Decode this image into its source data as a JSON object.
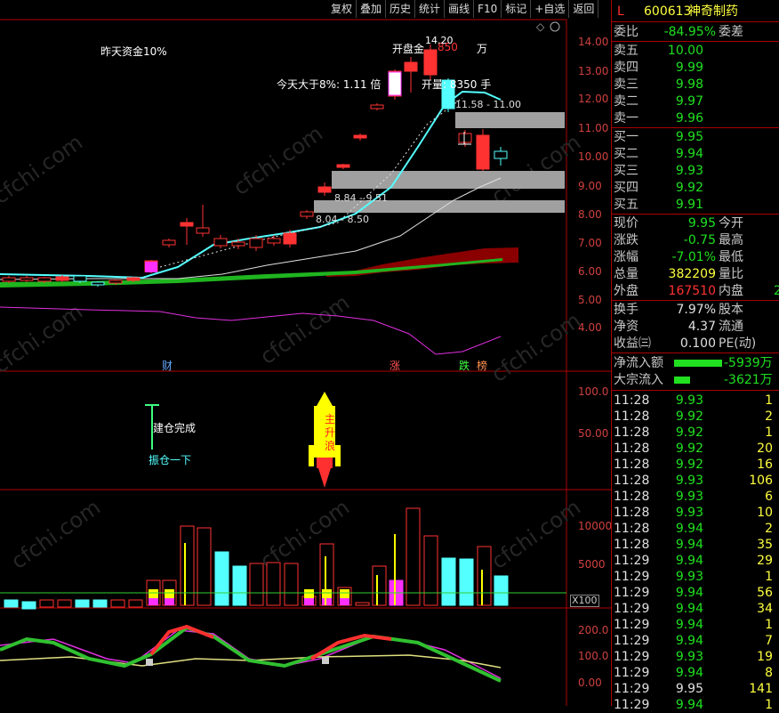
{
  "toolbar": [
    "复权",
    "叠加",
    "历史",
    "统计",
    "画线",
    "F10",
    "标记",
    "+自选",
    "返回"
  ],
  "stock": {
    "marker": "L",
    "code": "600613",
    "name": "神奇制药"
  },
  "annotations": {
    "prev_fund": "昨天资金10%",
    "today_gt8": "今天大于8%: 1.11 倍",
    "open_fund": "开盘金",
    "open_fund_val": "850",
    "open_fund_unit": "万",
    "open_volume": "开量: 8350 手",
    "high_label": "14.20",
    "range1": "11.58 - 11.00",
    "range2": "8.84 - 9.51",
    "range3": "8.04 - 8.50",
    "jiancang": "建仓完成",
    "zhencang": "振仓一下",
    "rocket": "主升浪",
    "cai": "财",
    "zhang": "涨",
    "die": "跌",
    "xian": "榜",
    "x100": "X100"
  },
  "price_axis": [
    "14.00",
    "13.00",
    "12.00",
    "11.00",
    "10.00",
    "9.00",
    "8.00",
    "7.00",
    "6.00",
    "5.00",
    "4.00"
  ],
  "ind1_axis": [
    "100.0",
    "50.00"
  ],
  "vol_axis": [
    "10000",
    "5000"
  ],
  "ind2_axis": [
    "200.0",
    "100.0",
    "0.00"
  ],
  "quote": {
    "weibi_label": "委比",
    "weibi_val": "-84.95%",
    "weicha_label": "委差",
    "sell": [
      {
        "label": "卖五",
        "price": "10.00"
      },
      {
        "label": "卖四",
        "price": "9.99"
      },
      {
        "label": "卖三",
        "price": "9.98"
      },
      {
        "label": "卖二",
        "price": "9.97"
      },
      {
        "label": "卖一",
        "price": "9.96"
      }
    ],
    "buy": [
      {
        "label": "买一",
        "price": "9.95"
      },
      {
        "label": "买二",
        "price": "9.94"
      },
      {
        "label": "买三",
        "price": "9.93"
      },
      {
        "label": "买四",
        "price": "9.92"
      },
      {
        "label": "买五",
        "price": "9.91"
      }
    ],
    "stats": [
      {
        "l1": "现价",
        "v1": "9.95",
        "l2": "今开"
      },
      {
        "l1": "涨跌",
        "v1": "-0.75",
        "l2": "最高"
      },
      {
        "l1": "涨幅",
        "v1": "-7.01%",
        "l2": "最低"
      },
      {
        "l1": "总量",
        "v1": "382209",
        "l2": "量比"
      },
      {
        "l1": "外盘",
        "v1": "167510",
        "l2": "内盘",
        "v2": "2"
      }
    ],
    "stats2": [
      {
        "l1": "换手",
        "v1": "7.97%",
        "l2": "股本"
      },
      {
        "l1": "净资",
        "v1": "4.37",
        "l2": "流通"
      },
      {
        "l1": "收益㈢",
        "v1": "0.100",
        "l2": "PE(动)"
      }
    ],
    "flows": [
      {
        "label": "净流入额",
        "val": "-5939万"
      },
      {
        "label": "大宗流入",
        "val": "-3621万"
      }
    ]
  },
  "ticks": [
    {
      "time": "11:28",
      "price": "9.93",
      "vol": "1"
    },
    {
      "time": "11:28",
      "price": "9.92",
      "vol": "2"
    },
    {
      "time": "11:28",
      "price": "9.92",
      "vol": "1"
    },
    {
      "time": "11:28",
      "price": "9.92",
      "vol": "20"
    },
    {
      "time": "11:28",
      "price": "9.92",
      "vol": "16"
    },
    {
      "time": "11:28",
      "price": "9.93",
      "vol": "106"
    },
    {
      "time": "11:28",
      "price": "9.93",
      "vol": "6"
    },
    {
      "time": "11:28",
      "price": "9.93",
      "vol": "10"
    },
    {
      "time": "11:28",
      "price": "9.94",
      "vol": "2"
    },
    {
      "time": "11:28",
      "price": "9.94",
      "vol": "35"
    },
    {
      "time": "11:29",
      "price": "9.94",
      "vol": "29"
    },
    {
      "time": "11:29",
      "price": "9.93",
      "vol": "1"
    },
    {
      "time": "11:29",
      "price": "9.94",
      "vol": "56"
    },
    {
      "time": "11:29",
      "price": "9.94",
      "vol": "34"
    },
    {
      "time": "11:29",
      "price": "9.94",
      "vol": "1"
    },
    {
      "time": "11:29",
      "price": "9.94",
      "vol": "7"
    },
    {
      "time": "11:29",
      "price": "9.93",
      "vol": "19"
    },
    {
      "time": "11:29",
      "price": "9.94",
      "vol": "8"
    },
    {
      "time": "11:29",
      "price": "9.95",
      "vol": "141"
    },
    {
      "time": "11:29",
      "price": "9.94",
      "vol": "1"
    }
  ],
  "colors": {
    "up": "#ff3232",
    "down": "#00e000",
    "cyan": "#54ffff",
    "axis": "#b00000"
  }
}
